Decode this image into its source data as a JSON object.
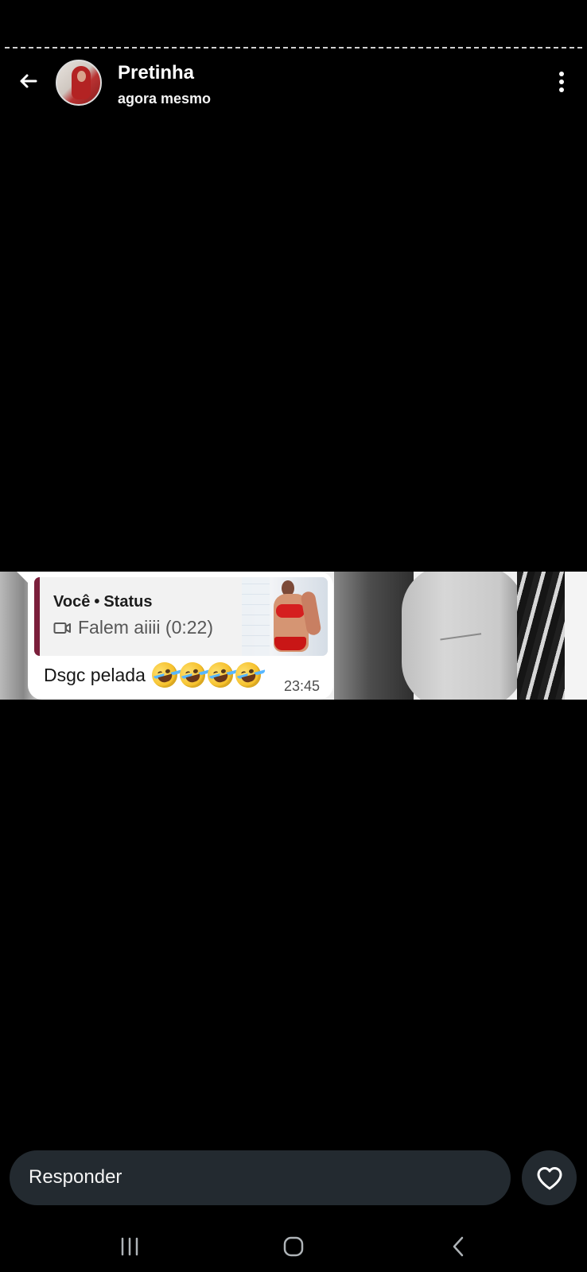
{
  "status": {
    "contact_name": "Pretinha",
    "posted_time": "agora mesmo"
  },
  "quoted_message": {
    "sender": "Você",
    "separator": "•",
    "context": "Status",
    "video_caption": "Falem aiiii (0:22)"
  },
  "message": {
    "text": "Dsgc pelada",
    "emojis": [
      "rolling-on-the-floor-laughing",
      "rolling-on-the-floor-laughing",
      "rolling-on-the-floor-laughing",
      "rolling-on-the-floor-laughing"
    ],
    "time": "23:45"
  },
  "reply": {
    "placeholder": "Responder"
  },
  "icons": {
    "back": "back-arrow-icon",
    "menu": "more-vertical-icon",
    "video": "video-icon",
    "heart": "heart-icon",
    "recent_apps": "recent-apps-icon",
    "home": "home-icon",
    "nav_back": "chevron-left-icon"
  },
  "colors": {
    "background": "#000000",
    "reply_box": "#232a30",
    "quote_accent": "#7b1f3b"
  }
}
